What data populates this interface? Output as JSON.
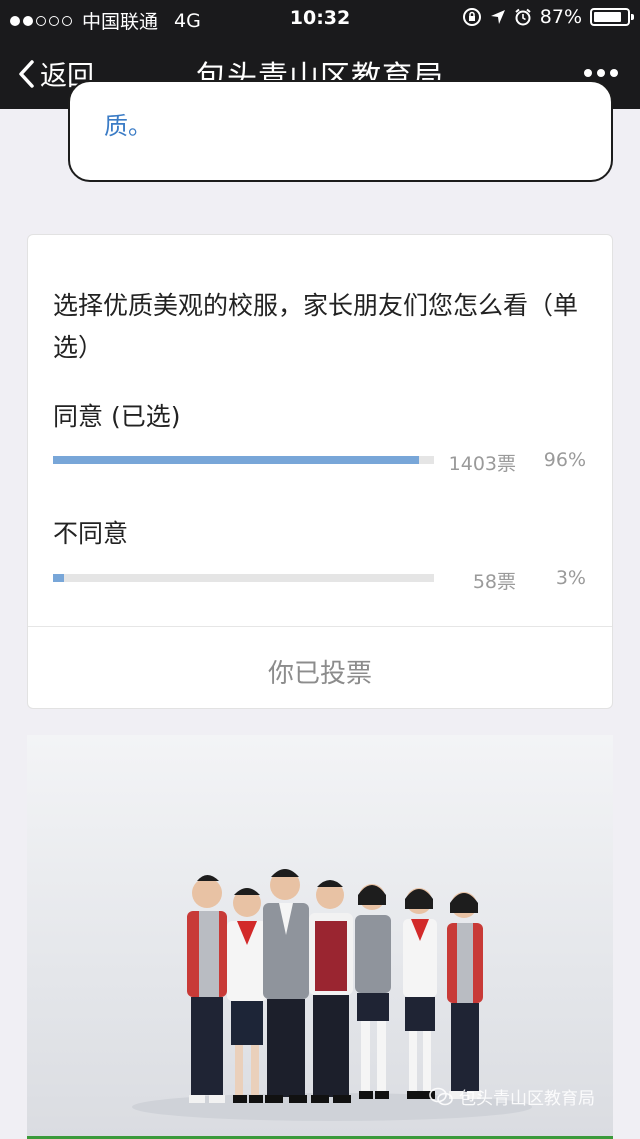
{
  "status_bar": {
    "carrier": "中国联通",
    "network": "4G",
    "time": "10:32",
    "battery_percent": "87%",
    "battery_level": 0.87
  },
  "nav": {
    "back_label": "返回",
    "title": "包头青山区教育局"
  },
  "prev_text": {
    "tail": "质。"
  },
  "vote": {
    "question": "选择优质美观的校服，家长朋友们您怎么看（单选）",
    "options": [
      {
        "label": "同意 (已选)",
        "count": "1403票",
        "percent": "96%",
        "fraction": 0.96
      },
      {
        "label": "不同意",
        "count": "58票",
        "percent": "3%",
        "fraction": 0.03
      }
    ],
    "voted_label": "你已投票"
  },
  "photo": {
    "watermark": "包头青山区教育局"
  },
  "colors": {
    "nav_bg": "#1a1a1c",
    "link_blue": "#3b7cc6",
    "bar_fill": "#78a6d8",
    "bar_track": "#e5e5e5"
  },
  "icons": [
    "back-chevron-icon",
    "more-dots-icon",
    "orientation-lock-icon",
    "location-arrow-icon",
    "alarm-icon",
    "battery-icon",
    "wechat-icon"
  ]
}
